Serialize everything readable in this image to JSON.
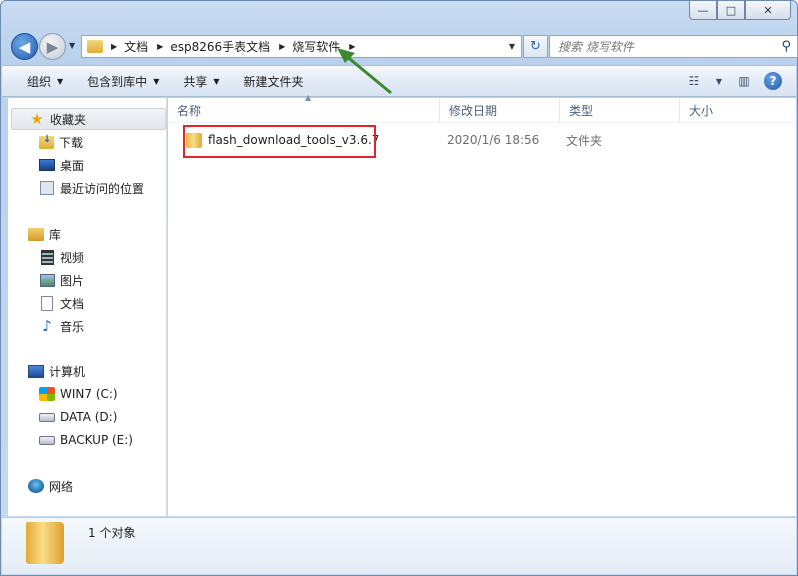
{
  "window": {
    "caption": {
      "minimize": "—",
      "maximize": "□",
      "close": "✕"
    }
  },
  "navigation": {
    "back_icon": "back-arrow-icon",
    "forward_icon": "forward-arrow-icon",
    "breadcrumbs": [
      "文档",
      "esp8266手表文档",
      "烧写软件"
    ],
    "search_placeholder": "搜索 烧写软件"
  },
  "toolbar": {
    "organize": "组织",
    "include_in_library": "包含到库中",
    "share": "共享",
    "new_folder": "新建文件夹"
  },
  "sidebar": {
    "favorites": {
      "label": "收藏夹",
      "items": [
        "下载",
        "桌面",
        "最近访问的位置"
      ]
    },
    "libraries": {
      "label": "库",
      "items": [
        "视频",
        "图片",
        "文档",
        "音乐"
      ]
    },
    "computer": {
      "label": "计算机",
      "items": [
        "WIN7 (C:)",
        "DATA (D:)",
        "BACKUP (E:)"
      ]
    },
    "network": {
      "label": "网络"
    }
  },
  "columns": [
    "名称",
    "修改日期",
    "类型",
    "大小"
  ],
  "files": [
    {
      "name": "flash_download_tools_v3.6.7",
      "modified": "2020/1/6 18:56",
      "type": "文件夹",
      "size": ""
    }
  ],
  "status": {
    "item_count": "1 个对象"
  },
  "colors": {
    "highlight": "#e3252a",
    "annotation_arrow": "#3c8a2e"
  }
}
